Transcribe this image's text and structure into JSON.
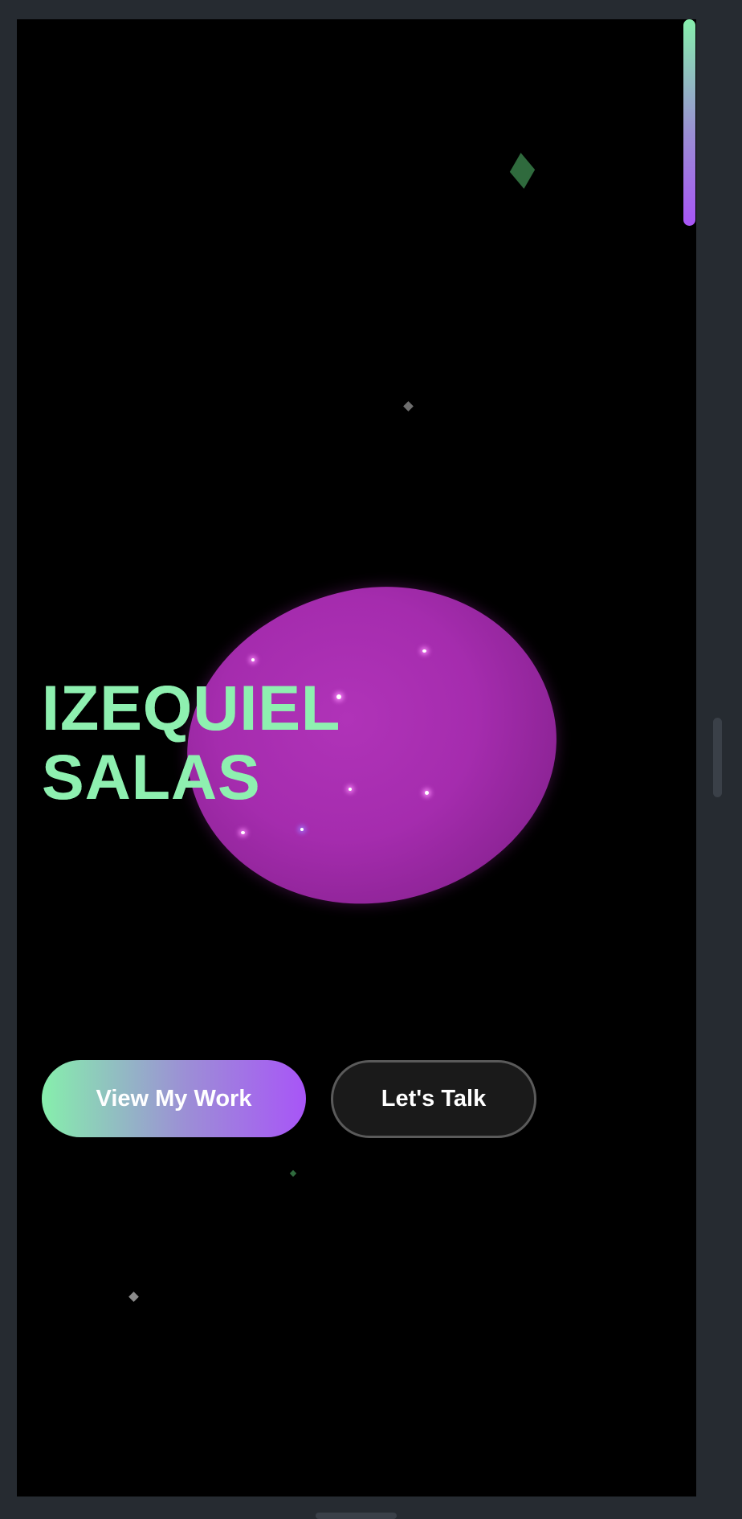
{
  "hero": {
    "name_line1": "IZEQUIEL",
    "name_line2": "SALAS"
  },
  "actions": {
    "primary_label": "View My Work",
    "secondary_label": "Let's Talk"
  },
  "colors": {
    "accent_green": "#86efac",
    "accent_purple": "#a855f7",
    "blob": "#a52cae",
    "background": "#000000"
  }
}
